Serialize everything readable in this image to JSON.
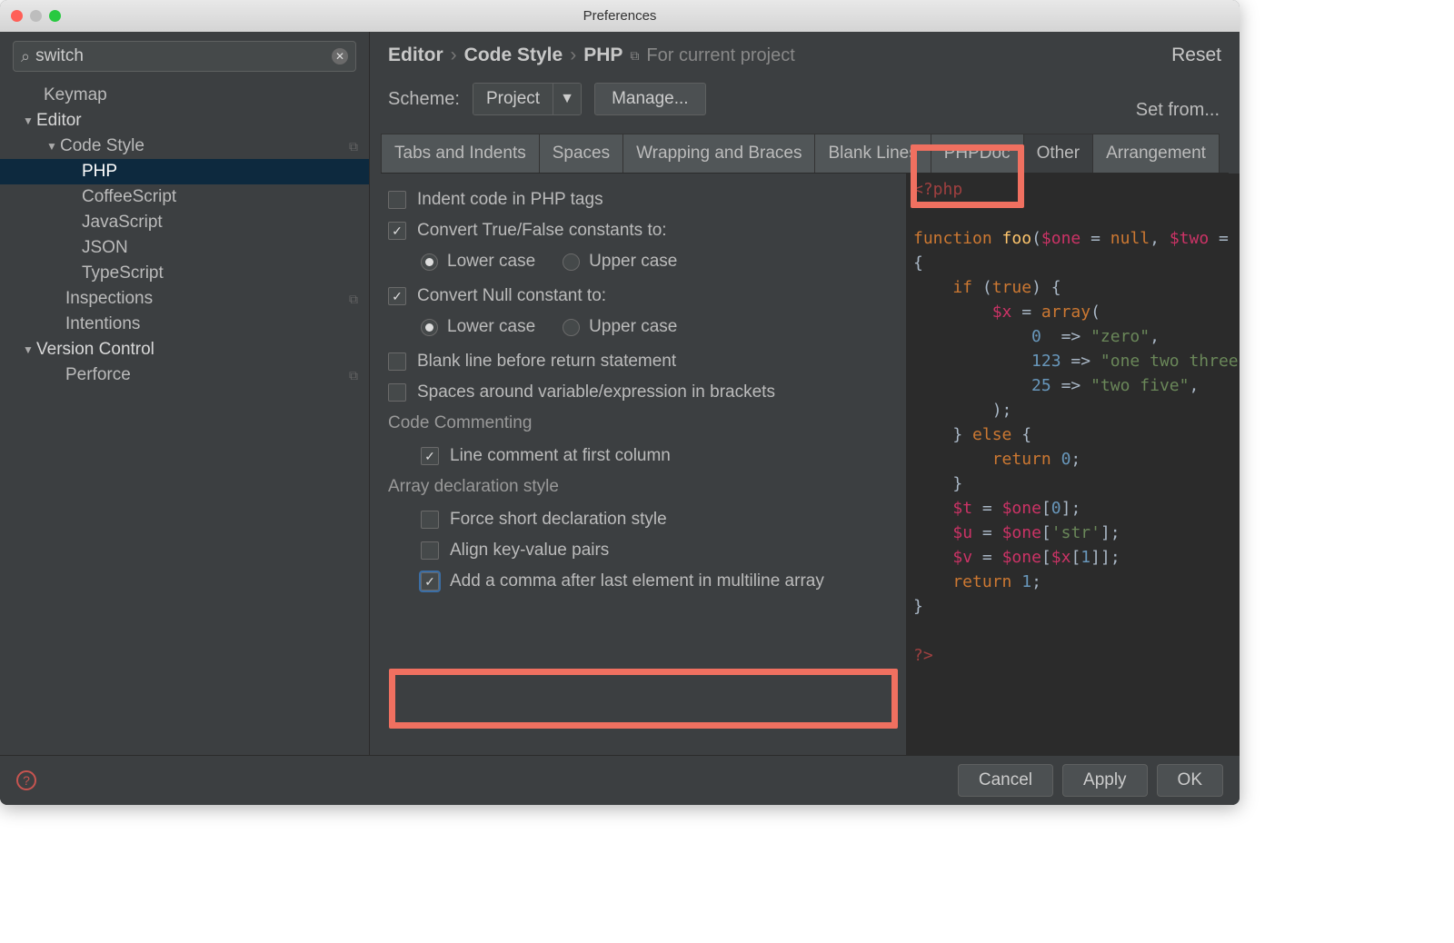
{
  "window": {
    "title": "Preferences"
  },
  "search": {
    "value": "switch"
  },
  "tree": {
    "keymap": "Keymap",
    "editor": "Editor",
    "codestyle": "Code Style",
    "php": "PHP",
    "coffee": "CoffeeScript",
    "js": "JavaScript",
    "json": "JSON",
    "ts": "TypeScript",
    "inspections": "Inspections",
    "intentions": "Intentions",
    "vc": "Version Control",
    "perforce": "Perforce"
  },
  "breadcrumb": {
    "a": "Editor",
    "b": "Code Style",
    "c": "PHP",
    "scope": "For current project",
    "reset": "Reset"
  },
  "scheme": {
    "label": "Scheme:",
    "value": "Project",
    "manage": "Manage...",
    "setfrom": "Set from..."
  },
  "tabs": {
    "t0": "Tabs and Indents",
    "t1": "Spaces",
    "t2": "Wrapping and Braces",
    "t3": "Blank Lines",
    "t4": "PHPDoc",
    "t5": "Other",
    "t6": "Arrangement"
  },
  "options": {
    "indent_code": "Indent code in PHP tags",
    "conv_tf": "Convert True/False constants to:",
    "lower": "Lower case",
    "upper": "Upper case",
    "conv_null": "Convert Null constant to:",
    "blank_return": "Blank line before return statement",
    "spaces_brackets": "Spaces around variable/expression in brackets",
    "code_commenting": "Code Commenting",
    "line_comment_first": "Line comment at first column",
    "array_decl": "Array declaration style",
    "force_short": "Force short declaration style",
    "align_kv": "Align key-value pairs",
    "add_comma": "Add a comma after last element in multiline array"
  },
  "code": {
    "l0": "<?php",
    "l2a": "function ",
    "l2b": "foo",
    "l2c": "(",
    "l2d": "$one",
    "l2e": " = ",
    "l2f": "null",
    "l2g": ", ",
    "l2h": "$two",
    "l2i": " =",
    "l3": "{",
    "l4a": "    if ",
    "l4b": "(",
    "l4c": "true",
    "l4d": ") {",
    "l5a": "        ",
    "l5b": "$x",
    "l5c": " = ",
    "l5d": "array",
    "l5e": "(",
    "l6a": "            ",
    "l6b": "0",
    "l6c": "  => ",
    "l6d": "\"zero\"",
    "l6e": ",",
    "l7a": "            ",
    "l7b": "123",
    "l7c": " => ",
    "l7d": "\"one two three",
    "l7e": "",
    "l8a": "            ",
    "l8b": "25",
    "l8c": " => ",
    "l8d": "\"two five\"",
    "l8e": ",",
    "l9": "        );",
    "l10a": "    } ",
    "l10b": "else ",
    "l10c": "{",
    "l11a": "        return ",
    "l11b": "0",
    "l11c": ";",
    "l12": "    }",
    "l13a": "    ",
    "l13b": "$t",
    "l13c": " = ",
    "l13d": "$one",
    "l13e": "[",
    "l13f": "0",
    "l13g": "];",
    "l14a": "    ",
    "l14b": "$u",
    "l14c": " = ",
    "l14d": "$one",
    "l14e": "[",
    "l14f": "'str'",
    "l14g": "];",
    "l15a": "    ",
    "l15b": "$v",
    "l15c": " = ",
    "l15d": "$one",
    "l15e": "[",
    "l15f": "$x",
    "l15g": "[",
    "l15h": "1",
    "l15i": "]];",
    "l16a": "    return ",
    "l16b": "1",
    "l16c": ";",
    "l17": "}",
    "l19": "?>"
  },
  "footer": {
    "cancel": "Cancel",
    "apply": "Apply",
    "ok": "OK"
  }
}
